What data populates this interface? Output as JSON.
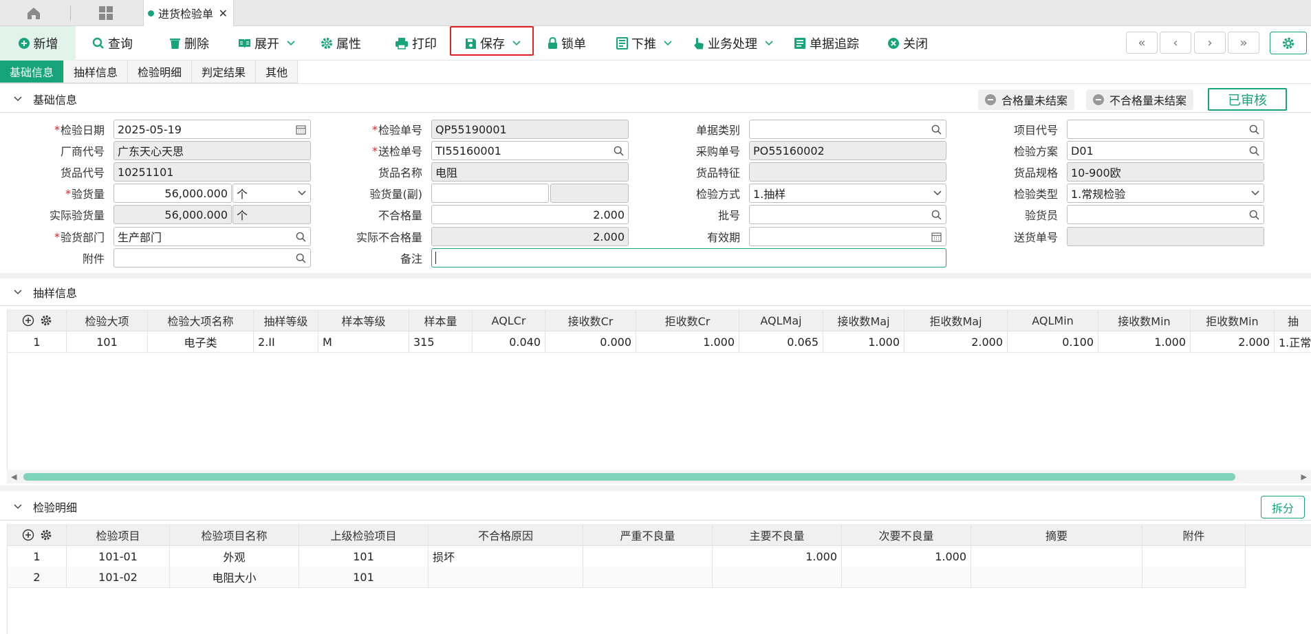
{
  "topbar": {
    "doc_tab_label": "进货检验单",
    "doc_tab_close": "✕"
  },
  "toolbar": {
    "new": "新增",
    "query": "查询",
    "delete": "删除",
    "expand": "展开",
    "properties": "属性",
    "print": "打印",
    "save": "保存",
    "lock": "锁单",
    "push_down": "下推",
    "business": "业务处理",
    "trace": "单据追踪",
    "close": "关闭",
    "nav": {
      "first": "«",
      "prev": "‹",
      "next": "›",
      "last": "»"
    }
  },
  "tabs": [
    "基础信息",
    "抽样信息",
    "检验明细",
    "判定结果",
    "其他"
  ],
  "sections": {
    "basic": "基础信息",
    "sampling": "抽样信息",
    "details": "检验明细"
  },
  "status": {
    "qualified_pending": "合格量未结案",
    "unqualified_pending": "不合格量未结案",
    "approved": "已审核"
  },
  "form": {
    "inspect_date": {
      "label": "检验日期",
      "value": "2025-05-19"
    },
    "vendor_code": {
      "label": "厂商代号",
      "value": "广东天心天思"
    },
    "item_code": {
      "label": "货品代号",
      "value": "10251101"
    },
    "inspect_qty": {
      "label": "验货量",
      "value": "56,000.000",
      "unit": "个"
    },
    "actual_qty": {
      "label": "实际验货量",
      "value": "56,000.000",
      "unit": "个"
    },
    "dept": {
      "label": "验货部门",
      "value": "生产部门"
    },
    "attachment": {
      "label": "附件",
      "value": ""
    },
    "inspect_no": {
      "label": "检验单号",
      "value": "QP55190001"
    },
    "delivery_inspect_no": {
      "label": "送检单号",
      "value": "TI55160001"
    },
    "item_name": {
      "label": "货品名称",
      "value": "电阻"
    },
    "inspect_qty_sub": {
      "label": "验货量(副)",
      "value": ""
    },
    "unqualified_qty": {
      "label": "不合格量",
      "value": "2.000"
    },
    "actual_unqualified": {
      "label": "实际不合格量",
      "value": "2.000"
    },
    "remark": {
      "label": "备注",
      "value": ""
    },
    "doc_type": {
      "label": "单据类别",
      "value": ""
    },
    "po_no": {
      "label": "采购单号",
      "value": "PO55160002"
    },
    "item_feature": {
      "label": "货品特征",
      "value": ""
    },
    "inspect_method": {
      "label": "检验方式",
      "value": "1.抽样"
    },
    "batch_no": {
      "label": "批号",
      "value": ""
    },
    "expiry": {
      "label": "有效期",
      "value": ""
    },
    "project_code": {
      "label": "项目代号",
      "value": ""
    },
    "inspect_plan": {
      "label": "检验方案",
      "value": "D01"
    },
    "item_spec": {
      "label": "货品规格",
      "value": "10-900欧"
    },
    "inspect_type": {
      "label": "检验类型",
      "value": "1.常规检验"
    },
    "inspector": {
      "label": "验货员",
      "value": ""
    },
    "delivery_no": {
      "label": "送货单号",
      "value": ""
    }
  },
  "sampling": {
    "columns": [
      "检验大项",
      "检验大项名称",
      "抽样等级",
      "样本等级",
      "样本量",
      "AQLCr",
      "接收数Cr",
      "拒收数Cr",
      "AQLMaj",
      "接收数Maj",
      "拒收数Maj",
      "AQLMin",
      "接收数Min",
      "拒收数Min",
      "抽"
    ],
    "rows": [
      {
        "no": "1",
        "cells": [
          "101",
          "电子类",
          "2.II",
          "M",
          "315",
          "0.040",
          "0.000",
          "1.000",
          "0.065",
          "1.000",
          "2.000",
          "0.100",
          "1.000",
          "2.000",
          "1.正常"
        ]
      }
    ]
  },
  "details": {
    "split": "拆分",
    "columns": [
      "检验项目",
      "检验项目名称",
      "上级检验项目",
      "不合格原因",
      "严重不良量",
      "主要不良量",
      "次要不良量",
      "摘要",
      "附件"
    ],
    "rows": [
      {
        "no": "1",
        "cells": [
          "101-01",
          "外观",
          "101",
          "损坏",
          "",
          "1.000",
          "1.000",
          "",
          ""
        ]
      },
      {
        "no": "2",
        "cells": [
          "101-02",
          "电阻大小",
          "101",
          "",
          "",
          "",
          "",
          "",
          ""
        ]
      }
    ]
  }
}
